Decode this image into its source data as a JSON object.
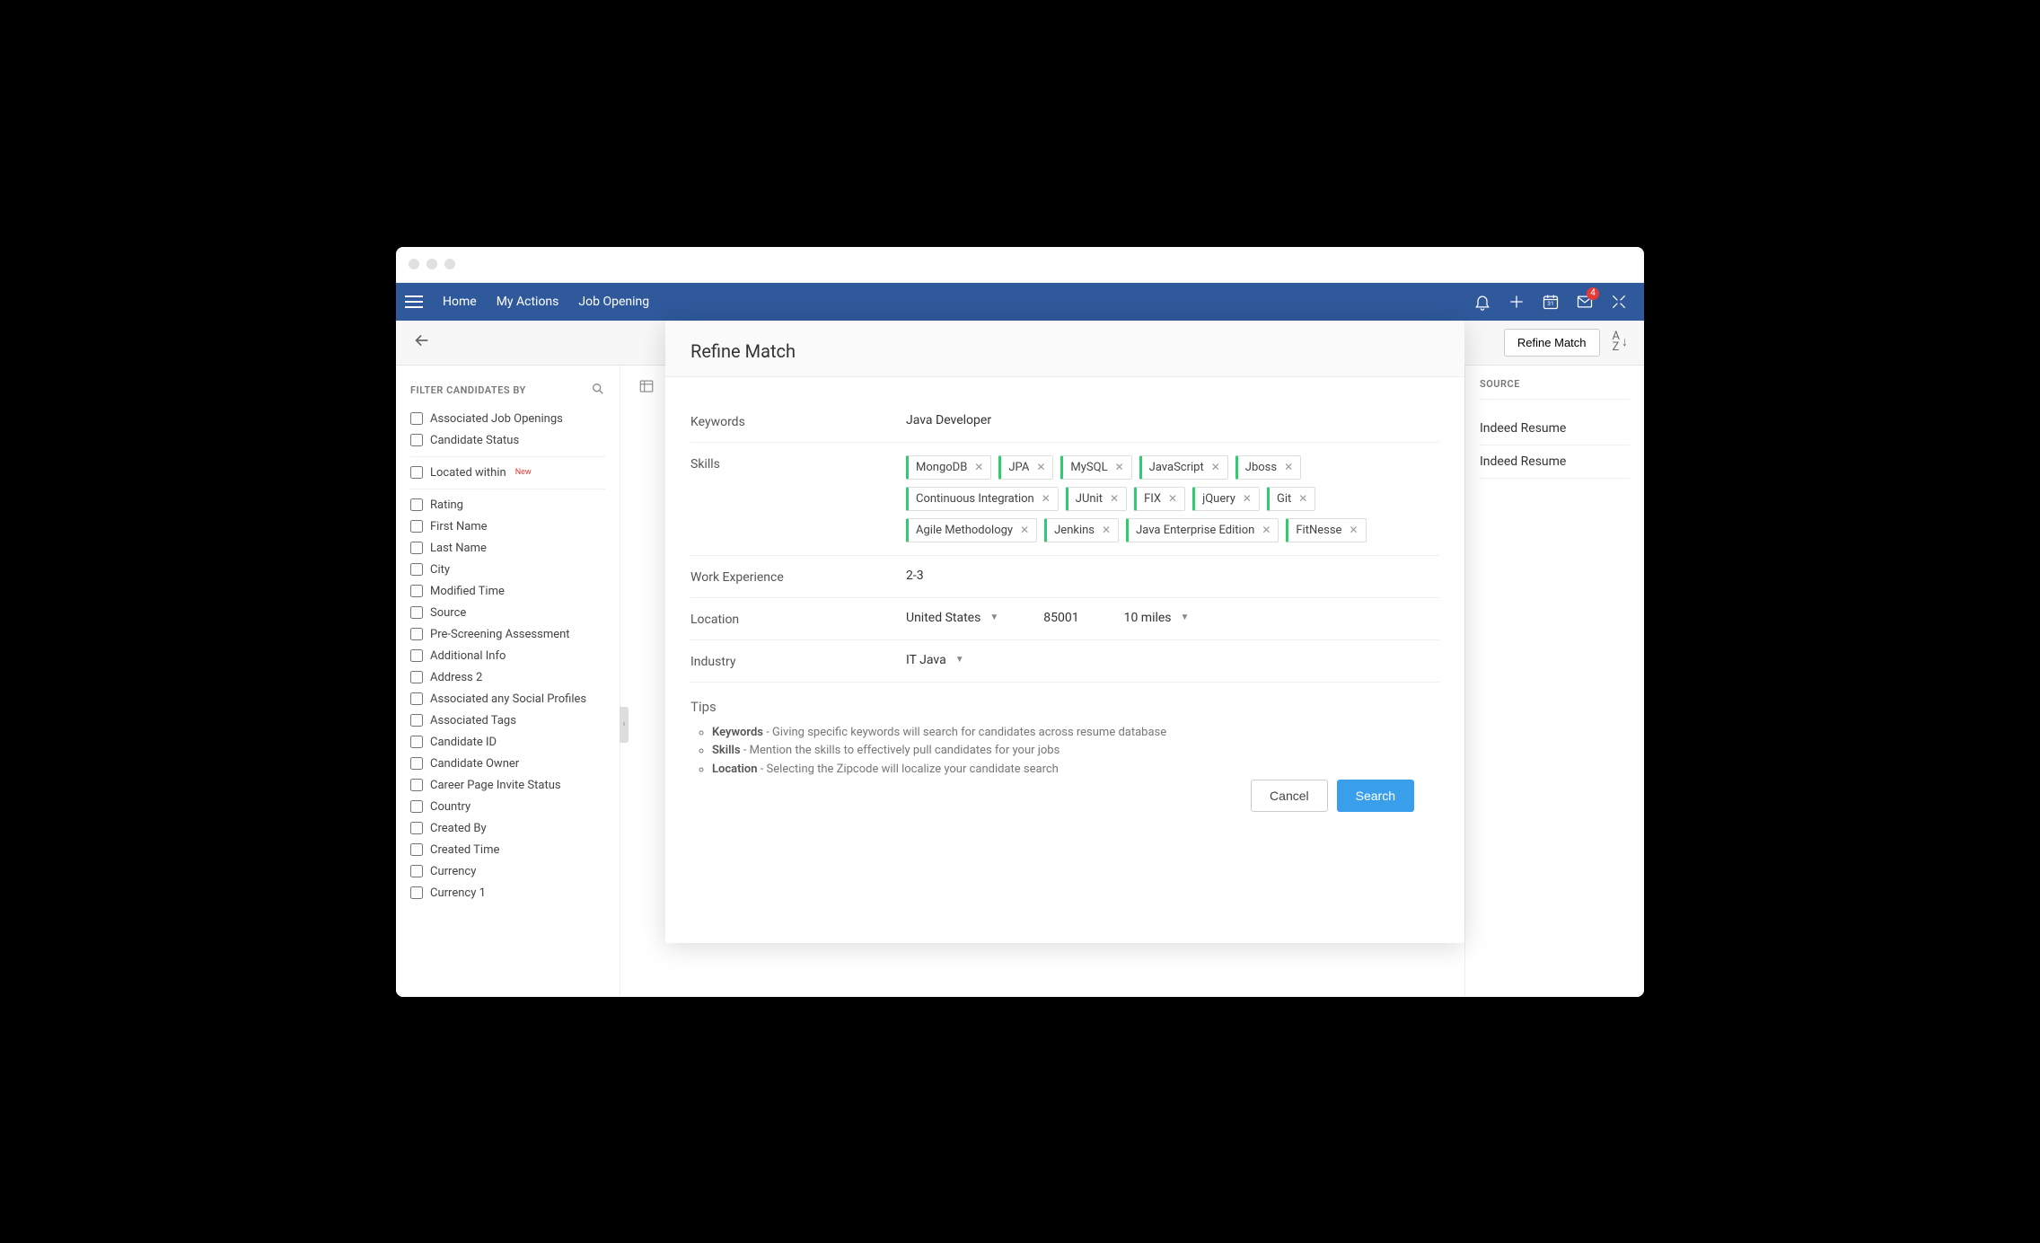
{
  "nav": {
    "items": [
      "Home",
      "My Actions",
      "Job Opening"
    ],
    "mail_badge": "4"
  },
  "toolbar": {
    "refine_button": "Refine Match",
    "sort_label": "A\nZ"
  },
  "filters": {
    "header": "FILTER CANDIDATES BY",
    "group1": [
      "Associated Job Openings",
      "Candidate Status"
    ],
    "located_within": "Located within",
    "new_tag": "New",
    "group2": [
      "Rating",
      "First Name",
      "Last Name",
      "City",
      "Modified Time",
      "Source",
      "Pre-Screening Assessment",
      "Additional Info",
      "Address 2",
      "Associated any Social Profiles",
      "Associated Tags",
      "Candidate ID",
      "Candidate Owner",
      "Career Page Invite Status",
      "Country",
      "Created By",
      "Created Time",
      "Currency",
      "Currency 1"
    ]
  },
  "right": {
    "header": "SOURCE",
    "items": [
      "Indeed Resume",
      "Indeed Resume"
    ]
  },
  "modal": {
    "title": "Refine Match",
    "keywords_label": "Keywords",
    "keywords_value": "Java Developer",
    "skills_label": "Skills",
    "skills": [
      "MongoDB",
      "JPA",
      "MySQL",
      "JavaScript",
      "Jboss",
      "Continuous Integration",
      "JUnit",
      "FIX",
      "jQuery",
      "Git",
      "Agile Methodology",
      "Jenkins",
      "Java Enterprise Edition",
      "FitNesse"
    ],
    "we_label": "Work Experience",
    "we_value": "2-3",
    "loc_label": "Location",
    "loc_country": "United States",
    "loc_zip": "85001",
    "loc_radius": "10 miles",
    "industry_label": "Industry",
    "industry_value": "IT Java",
    "tips_header": "Tips",
    "tips": [
      {
        "b": "Keywords",
        "t": " - Giving specific keywords will search for candidates across resume database"
      },
      {
        "b": "Skills",
        "t": " - Mention the skills to effectively pull candidates for your jobs"
      },
      {
        "b": "Location",
        "t": " - Selecting the Zipcode will localize your candidate search"
      }
    ],
    "cancel": "Cancel",
    "search": "Search"
  }
}
